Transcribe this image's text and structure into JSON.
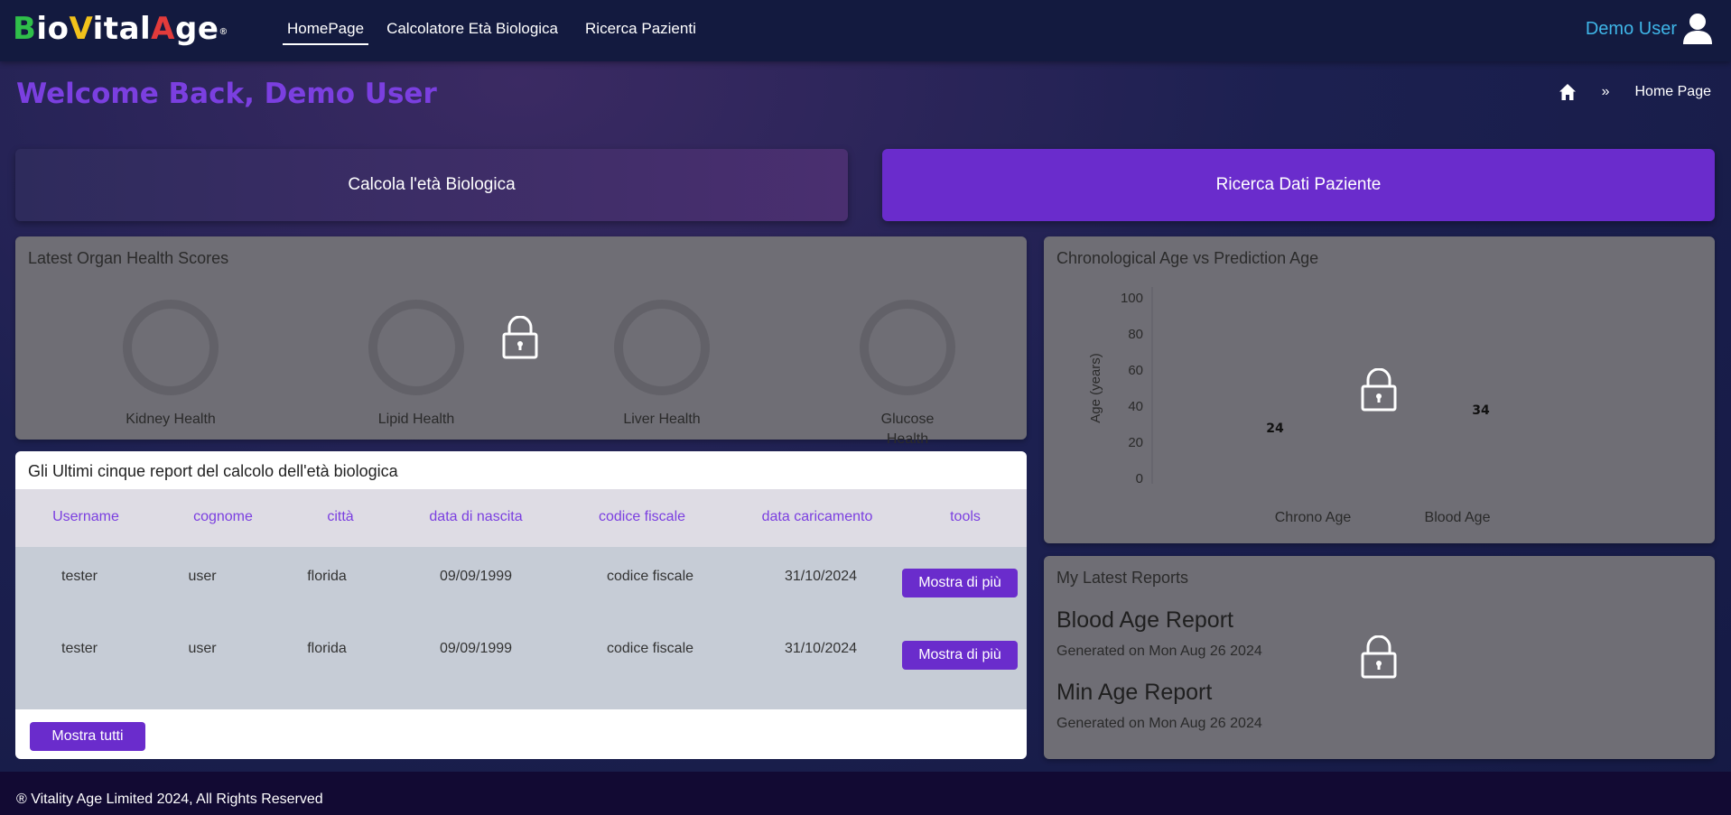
{
  "brand": {
    "parts": [
      {
        "text": "B",
        "color": "#2fbf4a"
      },
      {
        "text": "io",
        "color": "#ffffff"
      },
      {
        "text": "V",
        "color": "#f2c21b"
      },
      {
        "text": "ital",
        "color": "#ffffff"
      },
      {
        "text": "A",
        "color": "#e23b3b"
      },
      {
        "text": "ge",
        "color": "#ffffff"
      }
    ],
    "reg": "®"
  },
  "nav": {
    "items": [
      {
        "label": "HomePage",
        "active": true
      },
      {
        "label": "Calcolatore Età Biologica",
        "active": false
      },
      {
        "label": "Ricerca Pazienti",
        "active": false
      }
    ],
    "user_name": "Demo User"
  },
  "header": {
    "welcome": "Welcome Back, Demo User",
    "breadcrumb_sep": "»",
    "breadcrumb_current": "Home Page"
  },
  "actions": {
    "calc_label": "Calcola l'età Biologica",
    "search_label": "Ricerca Dati Paziente"
  },
  "organs": {
    "title": "Latest Organ Health Scores",
    "items": [
      {
        "label": "Kidney Health"
      },
      {
        "label": "Lipid Health"
      },
      {
        "label": "Liver Health"
      },
      {
        "label": "Glucose Health"
      }
    ]
  },
  "chart_data": {
    "type": "bar",
    "title": "Chronological Age vs Prediction Age",
    "categories": [
      "Chrono Age",
      "Blood Age"
    ],
    "values": [
      24,
      34
    ],
    "ylabel": "Age (years)",
    "xlabel": "",
    "ylim": [
      0,
      100
    ],
    "yticks": [
      0,
      20,
      40,
      60,
      80,
      100
    ],
    "grid": false,
    "locked": true
  },
  "reports_table": {
    "title": "Gli Ultimi cinque report del calcolo dell'età biologica",
    "columns": [
      "Username",
      "cognome",
      "città",
      "data di nascita",
      "codice fiscale",
      "data caricamento",
      "tools"
    ],
    "rows": [
      {
        "username": "tester",
        "cognome": "user",
        "citta": "florida",
        "nascita": "09/09/1999",
        "codice": "codice fiscale",
        "caricamento": "31/10/2024",
        "action": "Mostra di più"
      },
      {
        "username": "tester",
        "cognome": "user",
        "citta": "florida",
        "nascita": "09/09/1999",
        "codice": "codice fiscale",
        "caricamento": "31/10/2024",
        "action": "Mostra di più"
      }
    ],
    "show_all": "Mostra tutti"
  },
  "latest_reports": {
    "title": "My Latest Reports",
    "items": [
      {
        "name": "Blood Age Report",
        "date": "Generated on Mon Aug 26 2024"
      },
      {
        "name": "Min Age Report",
        "date": "Generated on Mon Aug 26 2024"
      }
    ]
  },
  "footer": {
    "text": "® Vitality Age Limited 2024, All Rights Reserved"
  },
  "colors": {
    "accent": "#6a2ccc",
    "accent_text": "#7b3fe0",
    "user": "#3fb6e8"
  }
}
